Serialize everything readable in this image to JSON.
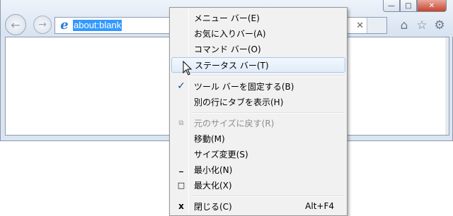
{
  "window": {
    "caption_buttons": {
      "minimize": "—",
      "maximize": "□",
      "close": "✕"
    }
  },
  "toolbar": {
    "back_glyph": "←",
    "forward_glyph": "→",
    "address_value": "about:blank",
    "clear_glyph": "✕",
    "home_glyph": "⌂",
    "favorites_glyph": "☆",
    "tools_glyph": "⚙"
  },
  "context_menu": {
    "items": [
      {
        "label": "メニュー バー(E)",
        "state": "normal",
        "glyph": ""
      },
      {
        "label": "お気に入りバー(A)",
        "state": "normal",
        "glyph": ""
      },
      {
        "label": "コマンド バー(O)",
        "state": "normal",
        "glyph": ""
      },
      {
        "label": "ステータス バー(T)",
        "state": "hover",
        "glyph": ""
      },
      {
        "label": "ツール バーを固定する(B)",
        "state": "checked",
        "glyph": "✓"
      },
      {
        "label": "別の行にタブを表示(H)",
        "state": "normal",
        "glyph": ""
      },
      {
        "label": "元のサイズに戻す(R)",
        "state": "disabled",
        "glyph": "⧉"
      },
      {
        "label": "移動(M)",
        "state": "normal",
        "glyph": ""
      },
      {
        "label": "サイズ変更(S)",
        "state": "normal",
        "glyph": ""
      },
      {
        "label": "最小化(N)",
        "state": "normal",
        "glyph": "_"
      },
      {
        "label": "最大化(X)",
        "state": "normal",
        "glyph": "□"
      },
      {
        "label": "閉じる(C)",
        "state": "normal",
        "glyph": "x",
        "shortcut": "Alt+F4"
      }
    ]
  }
}
